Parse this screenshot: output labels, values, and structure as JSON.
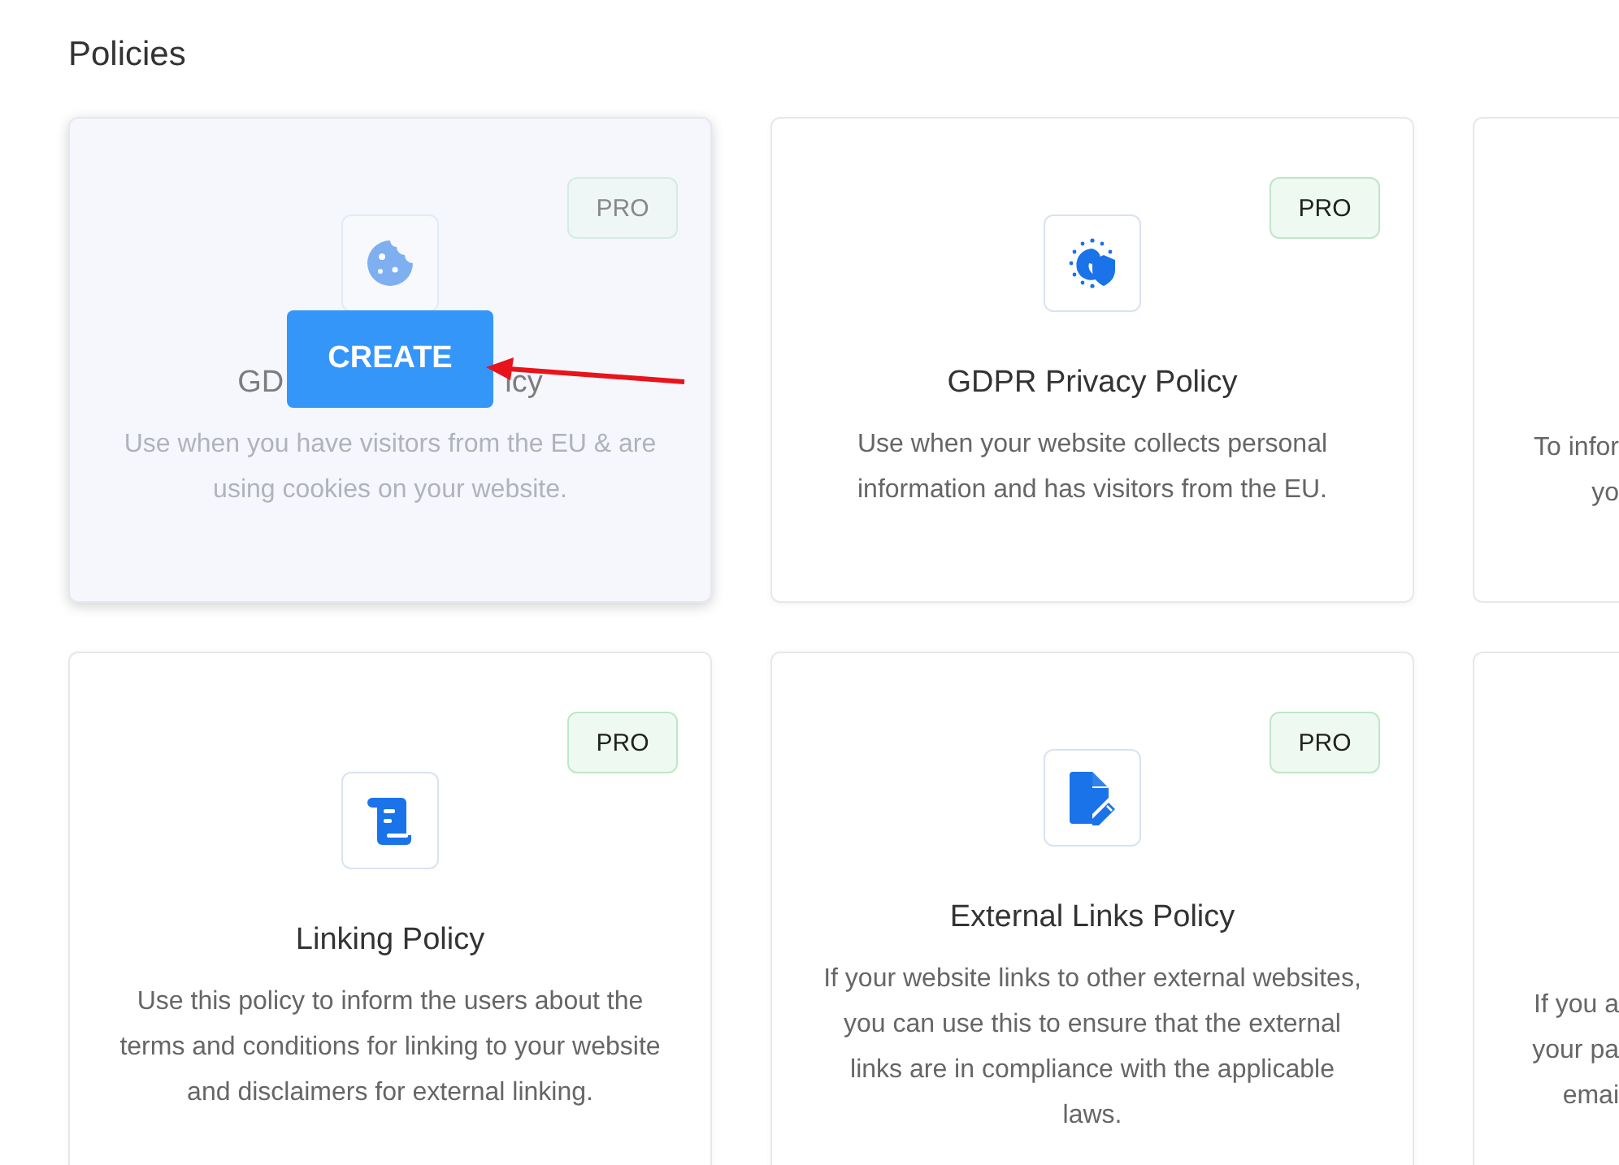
{
  "page_title": "Policies",
  "rows": [
    {
      "cards": [
        {
          "hovered": true,
          "badge": "PRO",
          "title_start": "GD",
          "title_end": "icy",
          "description": "Use when you have visitors from the EU & are using cookies on your website.",
          "action": "CREATE"
        },
        {
          "hovered": false,
          "badge": "PRO",
          "title": "GDPR Privacy Policy",
          "description": "Use when your website collects personal information and has visitors from the EU."
        }
      ],
      "partial": {
        "lines": [
          "To infor",
          "yo"
        ]
      }
    },
    {
      "cards": [
        {
          "hovered": false,
          "badge": "PRO",
          "title": "Linking Policy",
          "description": "Use this policy to inform the users about the terms and conditions for linking to your website and disclaimers for external linking."
        },
        {
          "hovered": false,
          "badge": "PRO",
          "title": "External Links Policy",
          "description": "If your website links to other external websites, you can use this to ensure that the external links are in compliance with the applicable laws."
        }
      ],
      "partial": {
        "lines": [
          "If you a",
          "your pa",
          "emai"
        ]
      }
    }
  ]
}
